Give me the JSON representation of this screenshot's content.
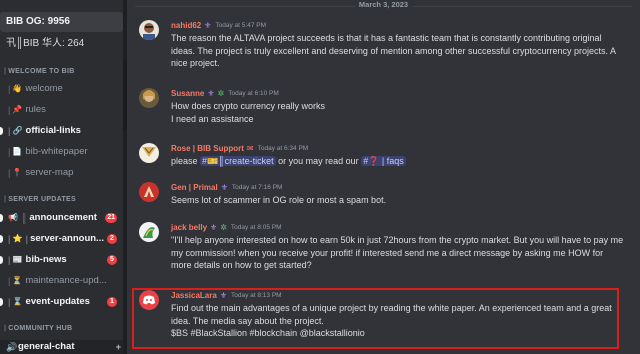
{
  "sidebar": {
    "stat_og": "BIB OG: 9956",
    "stat_cn": "卂║BIB 华人: 264",
    "categories": [
      {
        "label": "WELCOME TO BIB"
      },
      {
        "label": "SERVER UPDATES"
      },
      {
        "label": "COMMUNITY HUB"
      }
    ],
    "channels": [
      {
        "label": "welcome",
        "icon": "👋"
      },
      {
        "label": "rules",
        "icon": "📌"
      },
      {
        "label": "official-links",
        "icon": "🔗"
      },
      {
        "label": "bib-whitepaper",
        "icon": "📄"
      },
      {
        "label": "server-map",
        "icon": "📍"
      },
      {
        "label": "announcement",
        "icon": "📢",
        "badge": "21"
      },
      {
        "label": "server-announ...",
        "icon": "⭐",
        "badge": "2"
      },
      {
        "label": "bib-news",
        "icon": "📰",
        "badge": "5"
      },
      {
        "label": "maintenance-upd...",
        "icon": "⏳"
      },
      {
        "label": "event-updates",
        "icon": "⌛",
        "badge": "1"
      }
    ],
    "voice": {
      "label": "general-chat",
      "icon": "🔊",
      "add": "+"
    }
  },
  "chat": {
    "date_divider": "March 3, 2023",
    "messages": [
      {
        "user": "nahid62",
        "user_color": "#f47b67",
        "time": "Today at 5:47 PM",
        "lines": [
          "The reason the ALTAVA project succeeds is that it has a fantastic team that is constantly contributing original ideas. The project is truly excellent and deserving of mention among other successful cryptocurrency projects. A nice project."
        ]
      },
      {
        "user": "Susanne",
        "user_color": "#f47b67",
        "time": "Today at 6:10 PM",
        "lines": [
          "How does crypto currency really works",
          "I need an assistance"
        ]
      },
      {
        "user": "Rose | BIB Support",
        "user_color": "#f47b67",
        "time": "Today at 6:34 PM",
        "line_prefix": "please ",
        "channel1": "#🎫║create-ticket",
        "line_mid": " or you may read our ",
        "channel2": "#❓ | faqs"
      },
      {
        "user": "Gen | Primal",
        "user_color": "#f47b67",
        "time": "Today at 7:16 PM",
        "lines": [
          "Seems lot of scammer in OG role or most  a spam bot."
        ]
      },
      {
        "user": "jack belly",
        "user_color": "#f47b67",
        "time": "Today at 8:05 PM",
        "lines": [
          "\"I'll help anyone interested on how to earn 50k in just 72hours  from the crypto market. But you will have to pay me my commission! when you receive your profit! if interested send me a direct message by asking me HOW for more details on how to get started?"
        ]
      },
      {
        "user": "JassicaLara",
        "user_color": "#f47b67",
        "time": "Today at 8:13 PM",
        "lines": [
          "Find out the main advantages of a unique project by reading the white paper. An experienced team and a great idea. The media say about the project.",
          "$BS #BlackStallion #blockchain @blackstallionio"
        ]
      }
    ]
  },
  "colors": {
    "accent_red": "#d8201a",
    "badge_red": "#f23f42",
    "username": "#f47b67"
  }
}
